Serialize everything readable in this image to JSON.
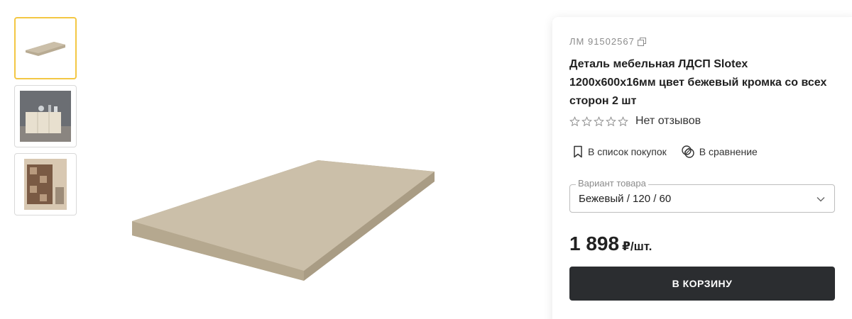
{
  "gallery": {
    "thumbnails": [
      {
        "name": "board-thumbnail",
        "active": true
      },
      {
        "name": "cabinet-thumbnail",
        "active": false
      },
      {
        "name": "shelving-thumbnail",
        "active": false
      }
    ],
    "main_image": "board-image"
  },
  "product": {
    "sku": "ЛМ 91502567",
    "title": "Деталь мебельная ЛДСП Slotex 1200х600х16мм цвет бежевый кромка со всех сторон 2 шт",
    "rating": {
      "stars_filled": 0,
      "stars_total": 5,
      "reviews_text": "Нет отзывов"
    },
    "shopping_list_label": "В список покупок",
    "compare_label": "В сравнение",
    "variant": {
      "label": "Вариант товара",
      "value": "Бежевый / 120 / 60"
    },
    "price": "1 898",
    "price_unit": "₽/шт.",
    "cart_button": "В КОРЗИНУ"
  },
  "icons": {
    "copy": "copy-icon",
    "star": "star-outline-icon",
    "bookmark": "bookmark-icon",
    "compare": "compare-icon",
    "chevron": "chevron-down-icon"
  },
  "colors": {
    "accent_thumb_border": "#f3c744",
    "button_bg": "#2b2d30",
    "board_top": "#cbbfa9",
    "board_edge": "#b8ab93"
  }
}
